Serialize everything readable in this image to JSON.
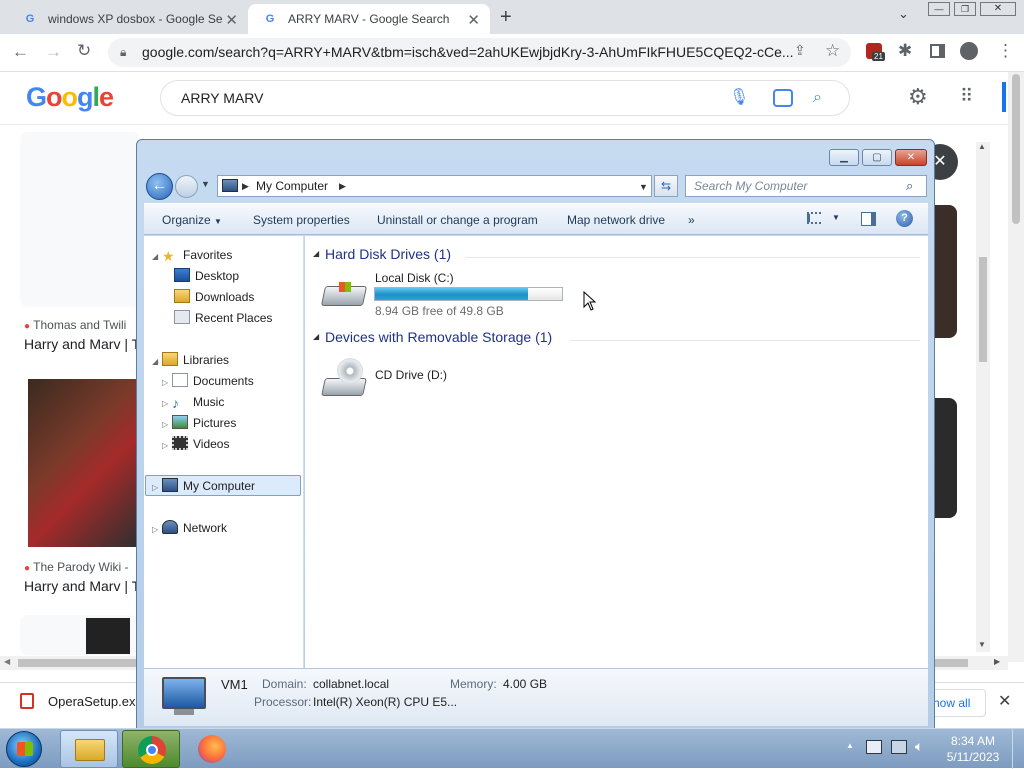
{
  "browser": {
    "tabs": [
      {
        "title": "windows XP dosbox - Google Se",
        "favicon": "google-g-icon",
        "active": false
      },
      {
        "title": "ARRY MARV - Google Search",
        "favicon": "google-g-icon",
        "active": true
      }
    ],
    "url": "google.com/search?q=ARRY+MARV&tbm=isch&ved=2ahUKEwjbjdKry-3-AhUmFIkFHUE5CQEQ2-cCe...",
    "extension_badge": "21"
  },
  "google": {
    "logo": "Google",
    "query": "ARRY MARV",
    "results": [
      {
        "source": "Thomas and Twili",
        "title": "Harry and Marv | T"
      },
      {
        "source": "The Parody Wiki -",
        "title": "Harry and Marv | T"
      }
    ],
    "right_button": "how all"
  },
  "download": {
    "filename": "OperaSetup.exe"
  },
  "explorer": {
    "address": {
      "location": "My Computer"
    },
    "search_placeholder": "Search My Computer",
    "commands": [
      "Organize",
      "System properties",
      "Uninstall or change a program",
      "Map network drive",
      "»"
    ],
    "nav": {
      "favorites_label": "Favorites",
      "favorites": [
        "Desktop",
        "Downloads",
        "Recent Places"
      ],
      "libraries_label": "Libraries",
      "libraries": [
        "Documents",
        "Music",
        "Pictures",
        "Videos"
      ],
      "my_computer": "My Computer",
      "network": "Network"
    },
    "groups": {
      "hard_disks": "Hard Disk Drives (1)",
      "removable": "Devices with Removable Storage (1)"
    },
    "drives": {
      "c_name": "Local Disk (C:)",
      "c_free": "8.94 GB free of 49.8 GB",
      "c_used_fraction": 0.82,
      "d_name": "CD Drive (D:)"
    },
    "details": {
      "name": "VM1",
      "domain_label": "Domain:",
      "domain": "collabnet.local",
      "memory_label": "Memory:",
      "memory": "4.00 GB",
      "processor_label": "Processor:",
      "processor": "Intel(R) Xeon(R) CPU E5..."
    }
  },
  "taskbar": {
    "time": "8:34 AM",
    "date": "5/11/2023"
  },
  "colors": {
    "accent": "#1a73e8",
    "explorer_frame": "#b3cde8",
    "disk_bar": "#26a0da"
  }
}
